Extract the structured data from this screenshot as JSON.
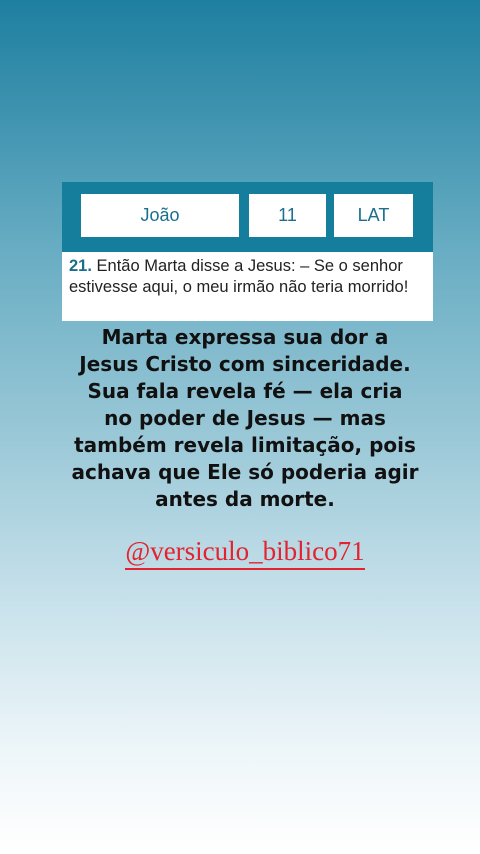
{
  "selector": {
    "book": "João",
    "chapter": "11",
    "version": "LAT"
  },
  "verse": {
    "number": "21.",
    "text": "Então Marta disse a Jesus: – Se o senhor estivesse aqui, o meu irmão não teria morrido!"
  },
  "commentary": "Marta expressa sua dor a Jesus Cristo com sinceridade. Sua fala revela fé — ela cria no poder de Jesus — mas também revela limitação, pois achava que Ele só poderia agir antes da morte.",
  "handle": "@versiculo_biblico71",
  "colors": {
    "header_bar": "#157e9c",
    "accent_text": "#1b6f8e",
    "handle_red": "#e3232f"
  }
}
